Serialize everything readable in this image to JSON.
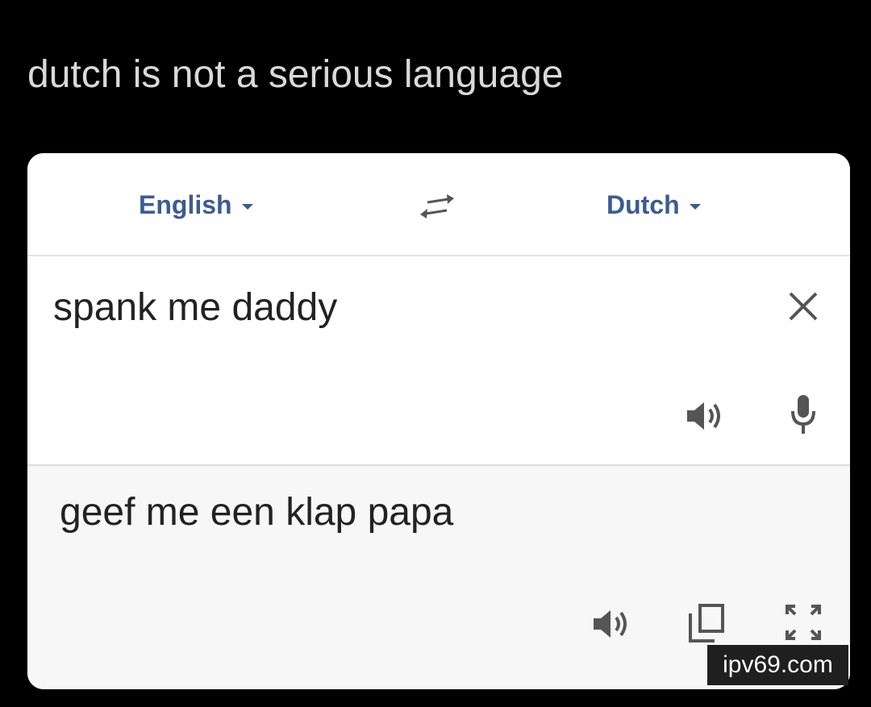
{
  "caption": "dutch is not a serious language",
  "translator": {
    "source_language": "English",
    "target_language": "Dutch",
    "input_text": "spank me daddy",
    "output_text": "geef me een klap papa",
    "icons": {
      "swap": "swap-arrows-icon",
      "clear": "close-icon",
      "listen_input": "speaker-icon",
      "microphone": "microphone-icon",
      "listen_output": "speaker-icon",
      "copy": "copy-icon",
      "fullscreen": "fullscreen-icon"
    },
    "colors": {
      "language_label": "#3b5b94",
      "icon": "#555555",
      "text": "#222222"
    }
  },
  "watermark": "ipv69.com"
}
